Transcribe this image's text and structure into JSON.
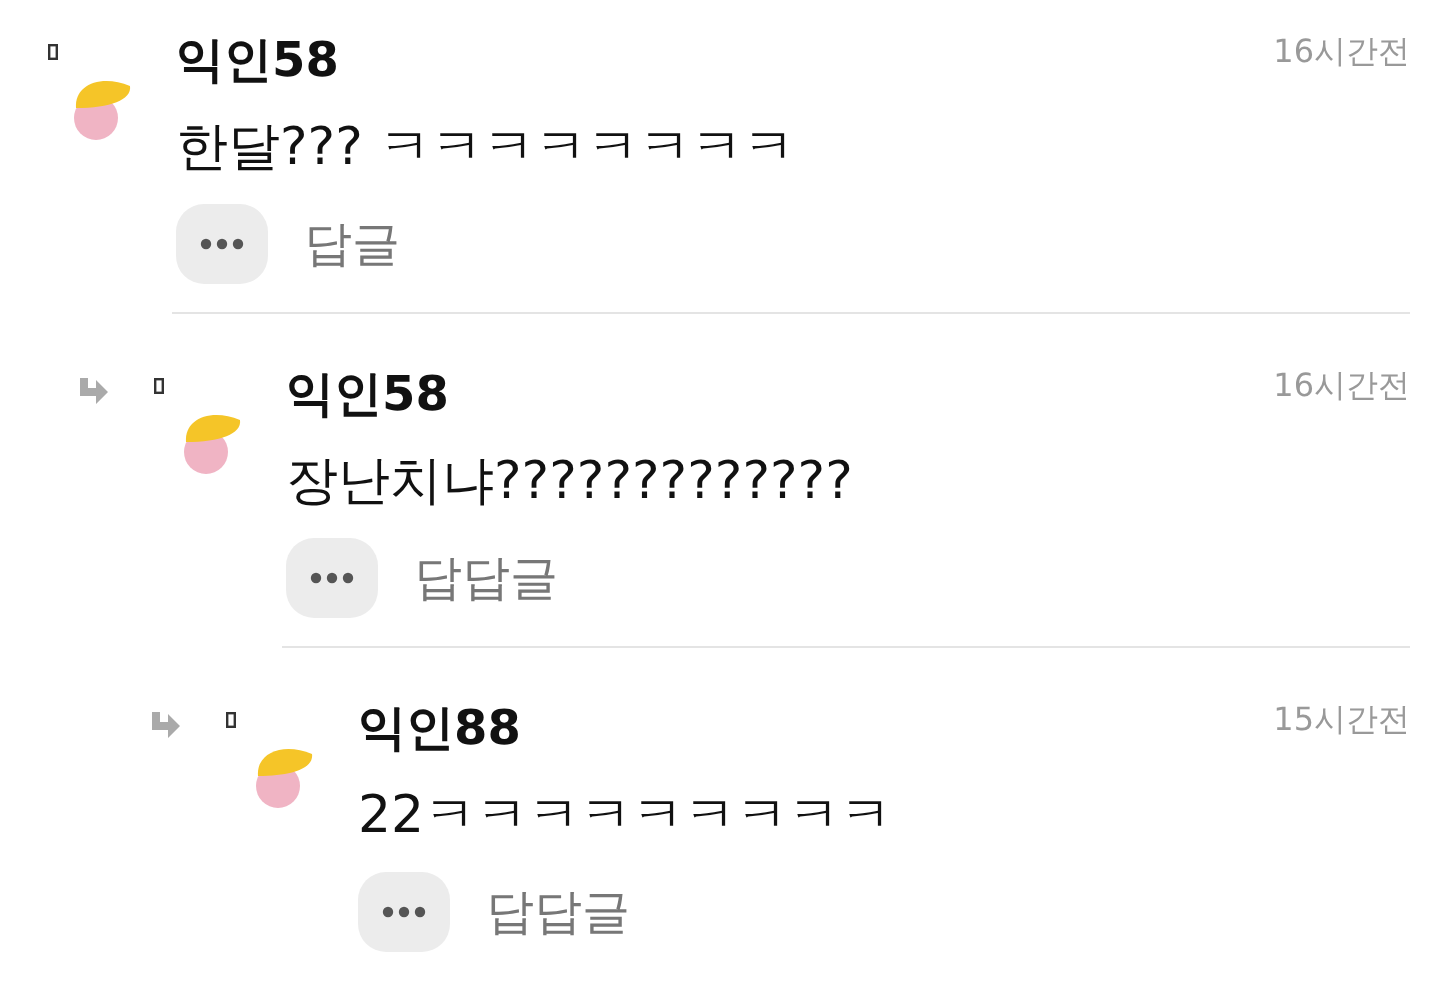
{
  "comments": [
    {
      "author": "익인58",
      "time": "16시간전",
      "text": "한달??? ㅋㅋㅋㅋㅋㅋㅋㅋ",
      "reply_label": "답글",
      "children": [
        {
          "author": "익인58",
          "time": "16시간전",
          "text": "장난치냐?????????????",
          "reply_label": "답답글",
          "children": [
            {
              "author": "익인88",
              "time": "15시간전",
              "text": "22ㅋㅋㅋㅋㅋㅋㅋㅋㅋ",
              "reply_label": "답답글"
            }
          ]
        }
      ]
    }
  ]
}
